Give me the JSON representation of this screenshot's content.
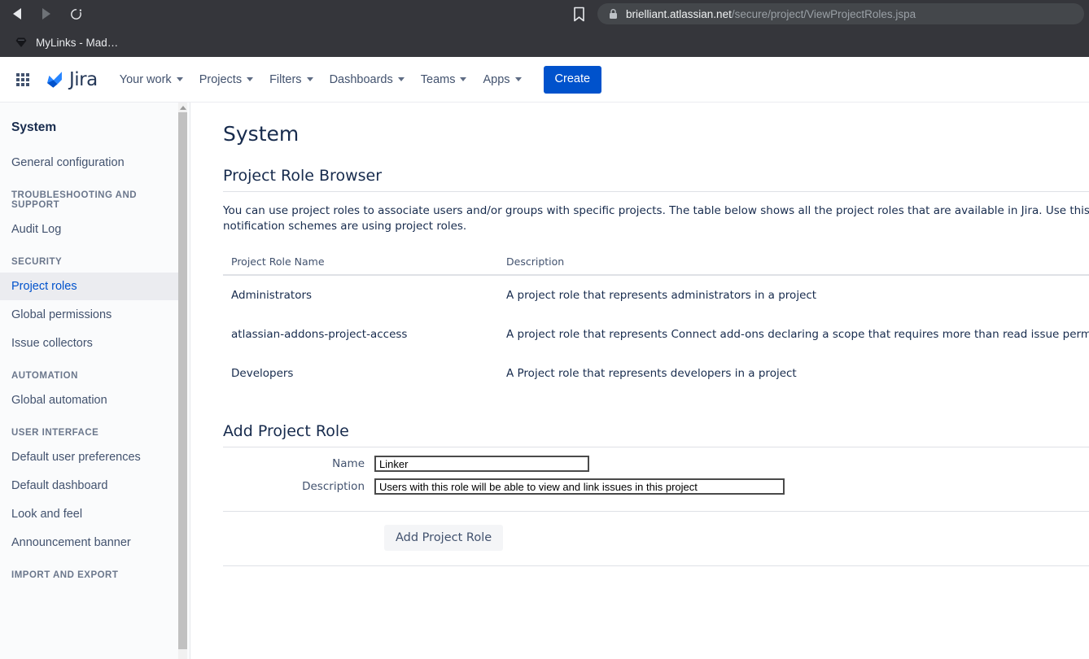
{
  "browser": {
    "back_label": "Back",
    "forward_label": "Forward",
    "reload_label": "Reload",
    "bookmark_label": "Bookmark this tab",
    "url_domain": "brielliant.atlassian.net",
    "url_path": "/secure/project/ViewProjectRoles.jspa",
    "tab_title": "MyLinks - Mad…"
  },
  "topnav": {
    "brand": "Jira",
    "items": [
      {
        "label": "Your work",
        "has_chevron": true
      },
      {
        "label": "Projects",
        "has_chevron": true
      },
      {
        "label": "Filters",
        "has_chevron": true
      },
      {
        "label": "Dashboards",
        "has_chevron": true
      },
      {
        "label": "Teams",
        "has_chevron": true
      },
      {
        "label": "Apps",
        "has_chevron": true
      }
    ],
    "create_label": "Create"
  },
  "sidebar": {
    "title": "System",
    "groups": [
      {
        "heading": "",
        "items": [
          {
            "label": "General configuration",
            "selected": false
          }
        ]
      },
      {
        "heading": "TROUBLESHOOTING AND SUPPORT",
        "items": [
          {
            "label": "Audit Log",
            "selected": false
          }
        ]
      },
      {
        "heading": "SECURITY",
        "items": [
          {
            "label": "Project roles",
            "selected": true
          },
          {
            "label": "Global permissions",
            "selected": false
          },
          {
            "label": "Issue collectors",
            "selected": false
          }
        ]
      },
      {
        "heading": "AUTOMATION",
        "items": [
          {
            "label": "Global automation",
            "selected": false
          }
        ]
      },
      {
        "heading": "USER INTERFACE",
        "items": [
          {
            "label": "Default user preferences",
            "selected": false
          },
          {
            "label": "Default dashboard",
            "selected": false
          },
          {
            "label": "Look and feel",
            "selected": false
          },
          {
            "label": "Announcement banner",
            "selected": false
          }
        ]
      },
      {
        "heading": "IMPORT AND EXPORT",
        "items": []
      }
    ]
  },
  "main": {
    "page_title": "System",
    "browser_section": {
      "heading": "Project Role Browser",
      "intro": "You can use project roles to associate users and/or groups with specific projects. The table below shows all the project roles that are available in Jira. Use this screen to add, edit and d\nnotification schemes are using project roles."
    },
    "table": {
      "columns": [
        "Project Role Name",
        "Description"
      ],
      "rows": [
        {
          "name": "Administrators",
          "description": "A project role that represents administrators in a project"
        },
        {
          "name": "atlassian-addons-project-access",
          "description": "A project role that represents Connect add-ons declaring a scope that requires more than read issue permissions"
        },
        {
          "name": "Developers",
          "description": "A Project role that represents developers in a project"
        }
      ]
    },
    "add_section": {
      "heading": "Add Project Role",
      "name_label": "Name",
      "name_value": "Linker",
      "name_placeholder": "",
      "description_label": "Description",
      "description_value": "Users with this role will be able to view and link issues in this project",
      "description_placeholder": "",
      "submit_label": "Add Project Role"
    }
  },
  "colors": {
    "brand_blue": "#0052cc",
    "chrome_bg": "#35363b",
    "sidebar_bg": "#fafbfc",
    "selected_item": "#0052cc",
    "text_primary": "#172b4d"
  }
}
